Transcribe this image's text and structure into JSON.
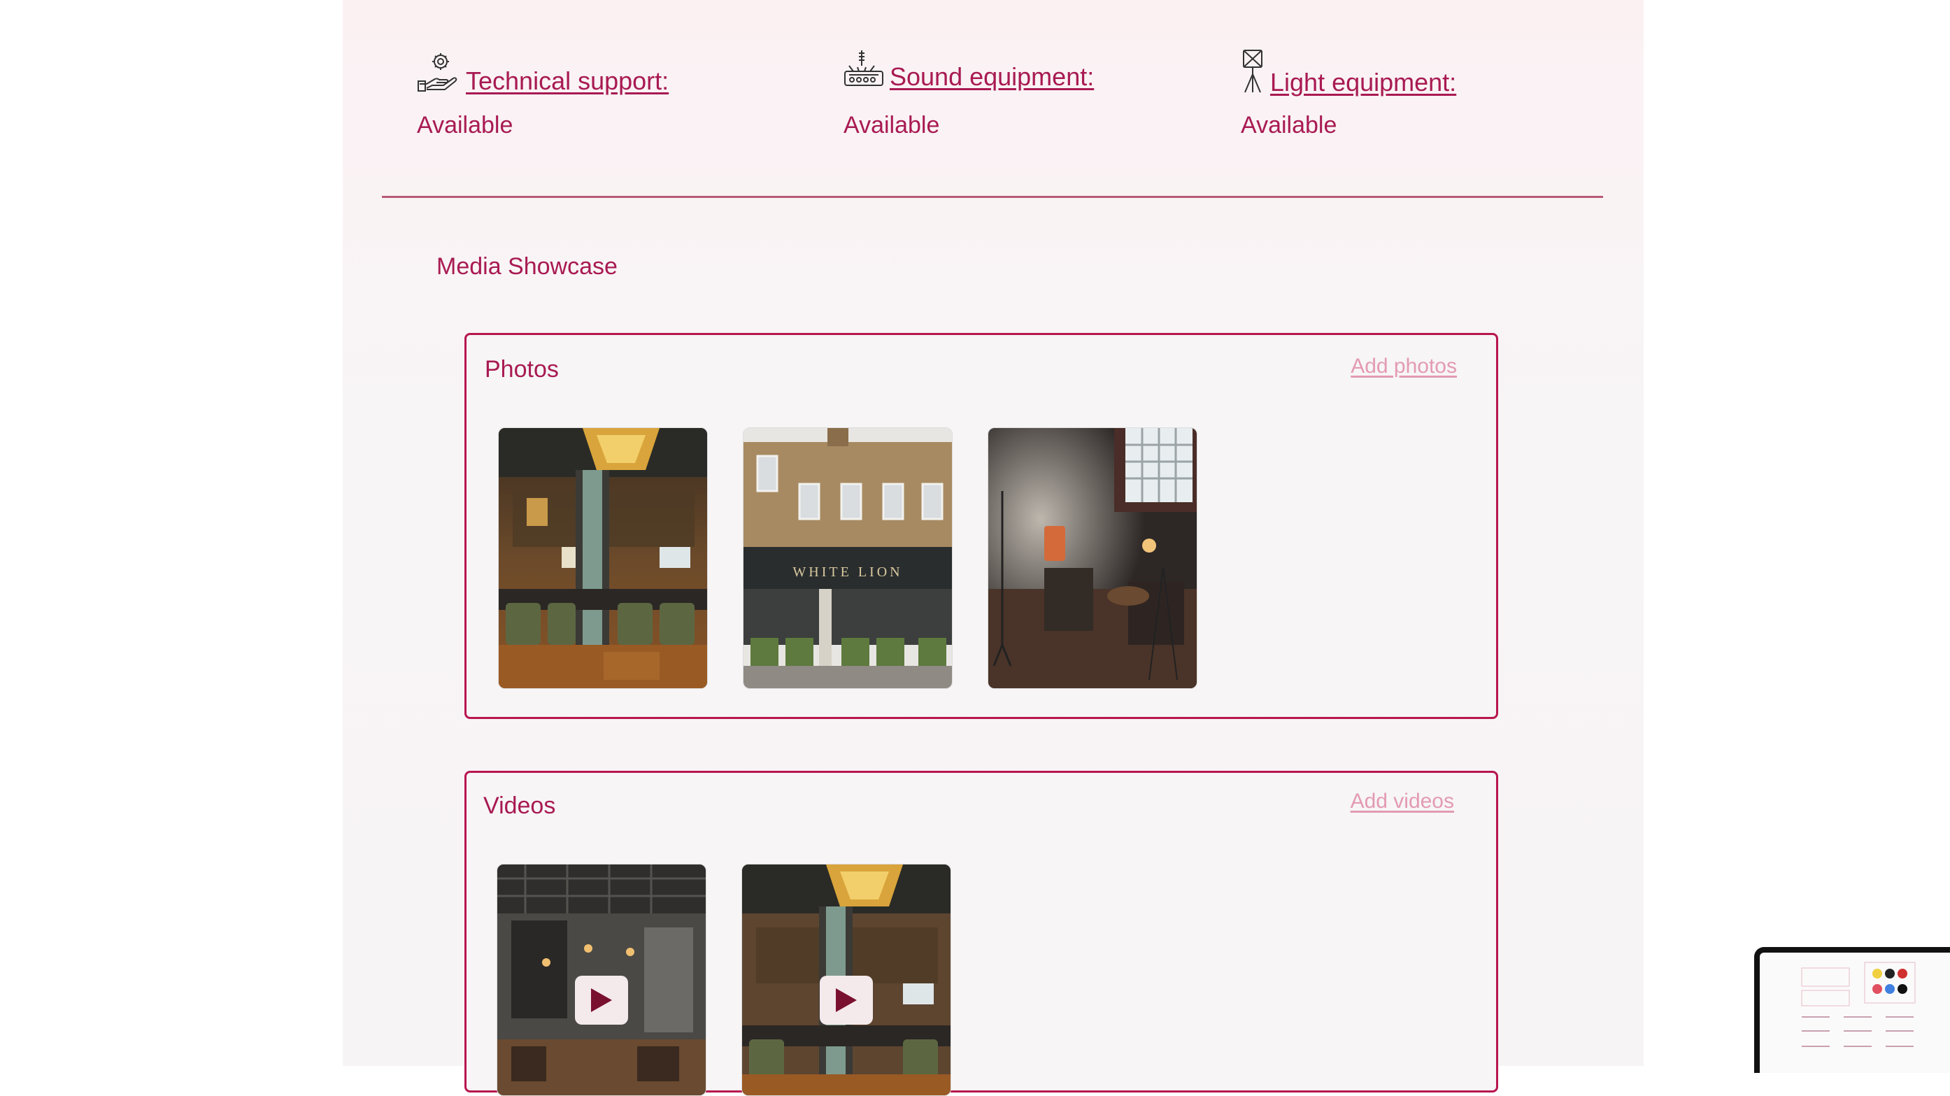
{
  "features": [
    {
      "title": "Technical support:",
      "value": "Available",
      "icon": "tech-support-icon"
    },
    {
      "title": "Sound equipment:",
      "value": "Available",
      "icon": "sound-equipment-icon"
    },
    {
      "title": "Light equipment:",
      "value": "Available",
      "icon": "light-equipment-icon"
    }
  ],
  "media": {
    "section_title": "Media Showcase",
    "photos": {
      "title": "Photos",
      "action": "Add photos",
      "items": [
        "pub-interior-photo",
        "white-lion-exterior-photo",
        "band-stage-photo"
      ],
      "sign_text": "WHITE LION"
    },
    "videos": {
      "title": "Videos",
      "action": "Add videos",
      "items": [
        "dining-room-video",
        "bar-interior-video"
      ]
    }
  },
  "colors": {
    "accent": "#a81a52",
    "border": "#b8164f",
    "link_muted": "#e39ab3",
    "panel_bg": "#f8f5f6"
  }
}
